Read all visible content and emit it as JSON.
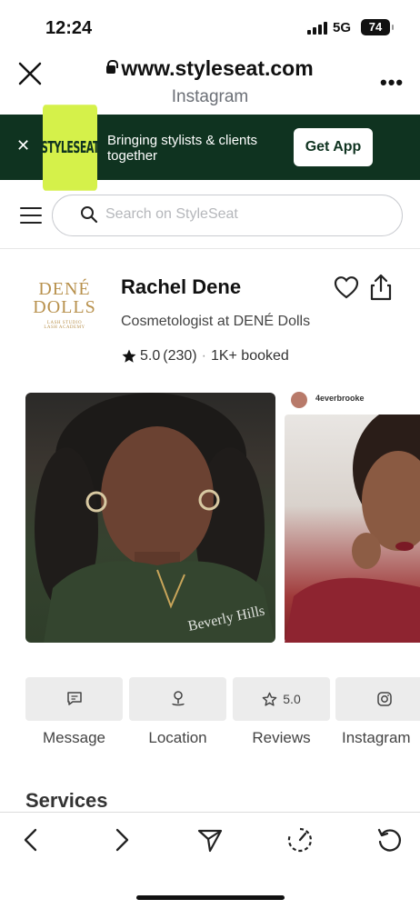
{
  "status_bar": {
    "time": "12:24",
    "network": "5G",
    "battery": "74"
  },
  "browser": {
    "url": "www.styleseat.com",
    "source": "Instagram",
    "close_icon": "close-icon",
    "more_icon": "more-icon"
  },
  "banner": {
    "logo_text": "STYLESEAT",
    "message": "Bringing stylists & clients together",
    "cta": "Get App",
    "colors": {
      "background": "#0f3320",
      "logo": "#d5f14a"
    }
  },
  "search": {
    "placeholder": "Search on StyleSeat"
  },
  "profile": {
    "logo": {
      "line1": "DENÉ",
      "line2": "DOLLS",
      "line3": "LASH STUDIO",
      "line4": "LASH ACADEMY"
    },
    "name": "Rachel Dene",
    "title": "Cosmetologist at DENÉ Dolls",
    "rating": "5.0",
    "reviews_count": "(230)",
    "booked": "1K+ booked"
  },
  "photos": {
    "second_handle": "4everbrooke"
  },
  "actions": [
    {
      "label": "Message",
      "icon": "message-icon",
      "badge": ""
    },
    {
      "label": "Location",
      "icon": "location-icon",
      "badge": ""
    },
    {
      "label": "Reviews",
      "icon": "star-icon",
      "badge": "5.0"
    },
    {
      "label": "Instagram",
      "icon": "instagram-icon",
      "badge": ""
    }
  ],
  "section_title": "Services"
}
